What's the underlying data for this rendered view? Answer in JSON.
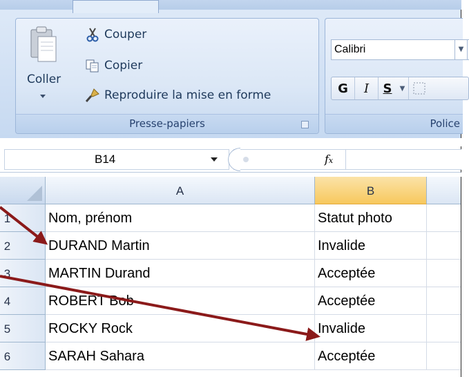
{
  "ribbon": {
    "clipboard": {
      "label": "Presse-papiers",
      "paste": "Coller",
      "cut": "Couper",
      "copy": "Copier",
      "format_painter": "Reproduire la mise en forme"
    },
    "font": {
      "label": "Police",
      "font_name": "Calibri",
      "bold": "G",
      "italic": "I",
      "underline": "S"
    }
  },
  "formula_bar": {
    "name_box": "B14",
    "fx": "fx",
    "value": ""
  },
  "sheet": {
    "columns": [
      "A",
      "B"
    ],
    "selected_column": "B",
    "rows": [
      {
        "num": "1",
        "a": "Nom, prénom",
        "b": "Statut photo"
      },
      {
        "num": "2",
        "a": "DURAND Martin",
        "b": "Invalide"
      },
      {
        "num": "3",
        "a": "MARTIN Durand",
        "b": "Acceptée"
      },
      {
        "num": "4",
        "a": "ROBERT Bob",
        "b": "Acceptée"
      },
      {
        "num": "5",
        "a": "ROCKY Rock",
        "b": "Invalide"
      },
      {
        "num": "6",
        "a": "SARAH Sahara",
        "b": "Acceptée"
      }
    ]
  },
  "colors": {
    "annotation_arrow": "#8b1a1a",
    "selected_header": "#f7c85d",
    "ribbon_text": "#1e395b"
  }
}
